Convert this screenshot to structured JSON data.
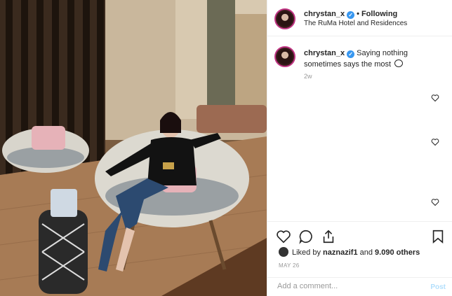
{
  "header": {
    "username": "chrystan_x",
    "separator": "•",
    "follow_status": "Following",
    "location": "The RuMa Hotel and Residences",
    "verified_icon": "verified-badge-icon"
  },
  "caption": {
    "username": "chrystan_x",
    "text": "Saying nothing sometimes says the most",
    "time": "2w",
    "emoji_icon": "speech-bubble-icon"
  },
  "actions": {
    "icons": [
      "heart-icon",
      "comment-icon",
      "share-icon",
      "bookmark-icon"
    ]
  },
  "likes": {
    "prefix": "Liked by",
    "user": "naznazif1",
    "middle": "and",
    "others": "9.090 others"
  },
  "date": "MAY 26",
  "comment_box": {
    "placeholder": "Add a comment...",
    "post_label": "Post"
  },
  "colors": {
    "verified": "#3897f0",
    "ring": "#c13584",
    "post_disabled": "#b2dffc",
    "muted": "#999999"
  }
}
